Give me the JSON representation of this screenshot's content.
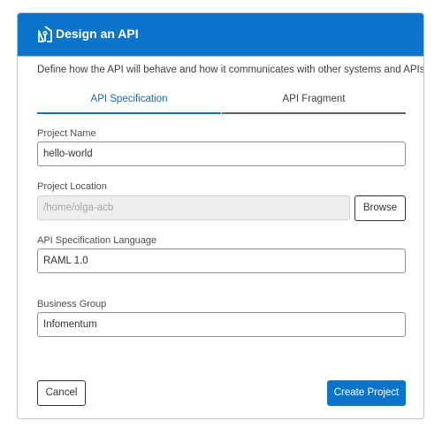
{
  "dialog": {
    "title": "Design an API",
    "description": "Define how the API will behave and how it communicates with other systems and APIs.",
    "tabs": [
      {
        "label": "API Specification",
        "active": true
      },
      {
        "label": "API Fragment",
        "active": false
      }
    ],
    "fields": {
      "project_name": {
        "label": "Project Name",
        "value": "hello-world"
      },
      "project_location": {
        "label": "Project Location",
        "value": "/home/olga-acb",
        "disabled": true
      },
      "spec_language": {
        "label": "API Specification Language",
        "value": "RAML 1.0"
      },
      "business_group": {
        "label": "Business Group",
        "value": "Infomentum"
      }
    },
    "buttons": {
      "browse": "Browse",
      "cancel": "Cancel",
      "create": "Create Project"
    },
    "icon": "api-design-icon",
    "colors": {
      "accent": "#0d74cc",
      "header_text": "#ffffff"
    }
  }
}
